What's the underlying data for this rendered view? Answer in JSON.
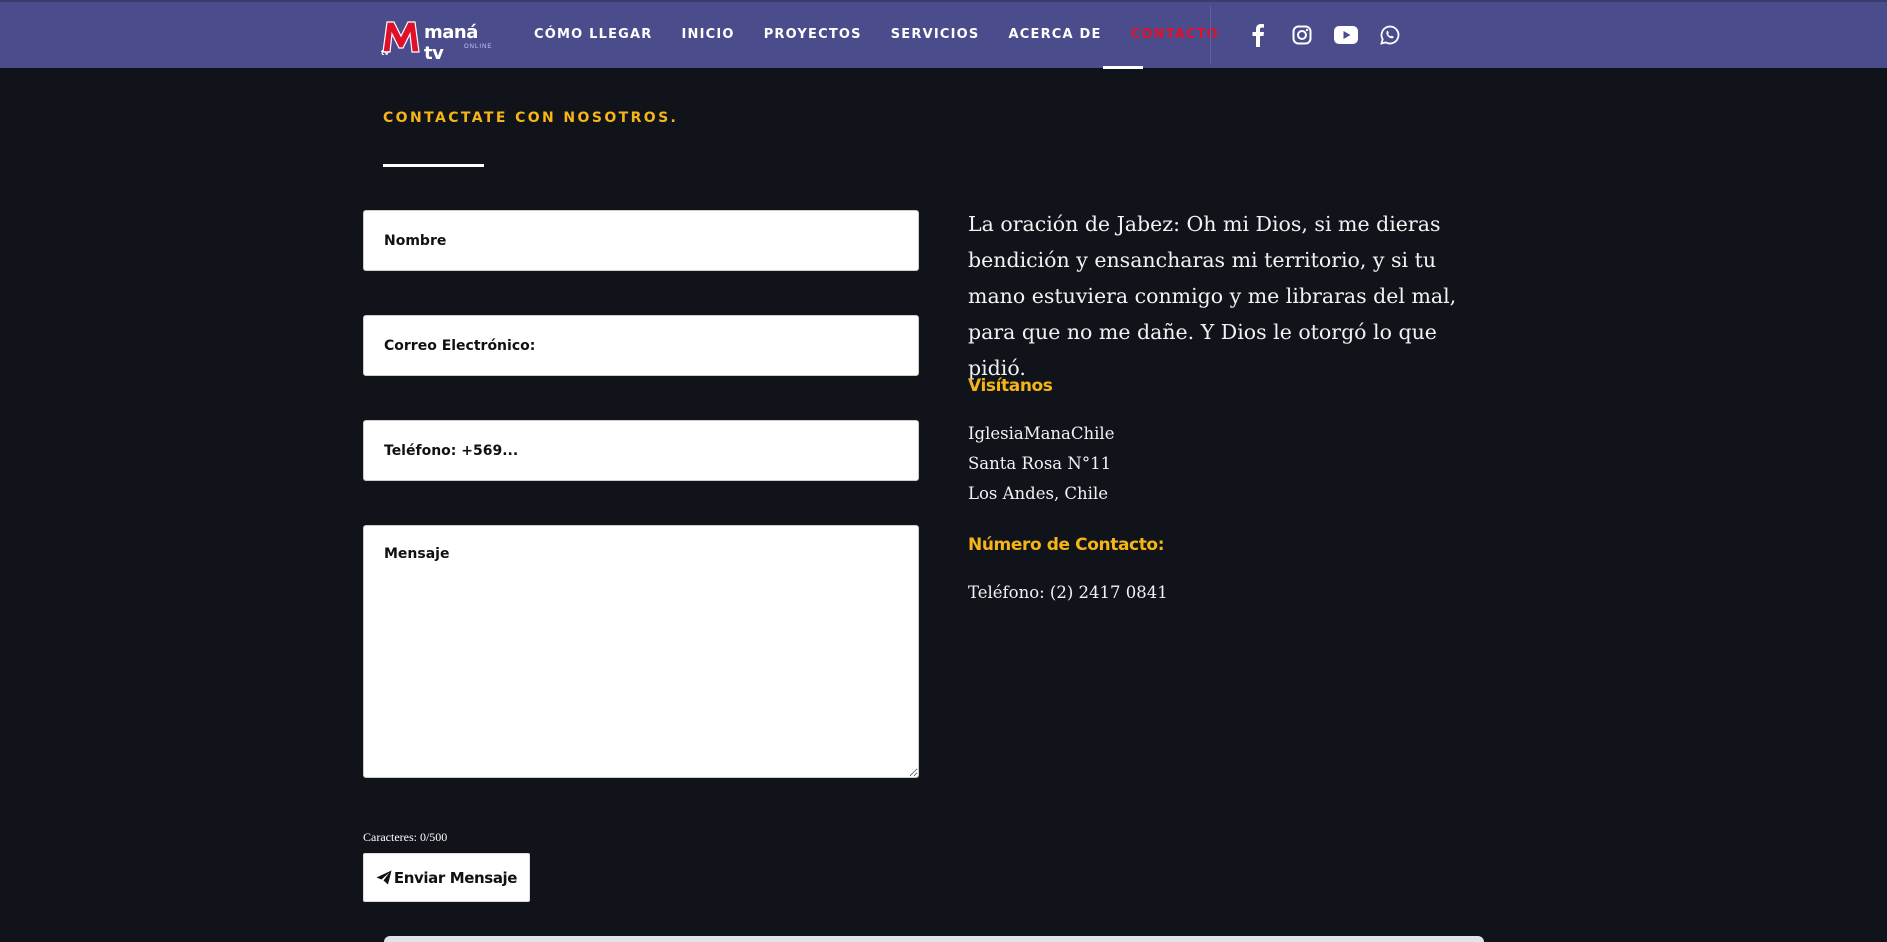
{
  "header": {
    "logo_text": "maná tv",
    "logo_sub": "ONLINE",
    "nav": [
      {
        "label": "CÓMO LLEGAR"
      },
      {
        "label": "INICIO"
      },
      {
        "label": "PROYECTOS"
      },
      {
        "label": "SERVICIOS"
      },
      {
        "label": "ACERCA DE"
      },
      {
        "label": "CONTACTO",
        "active": true
      }
    ],
    "social": [
      "facebook-icon",
      "instagram-icon",
      "youtube-icon",
      "whatsapp-icon"
    ],
    "colors": {
      "bar": "#4b4c8c",
      "active": "#e0102a"
    }
  },
  "contact": {
    "heading": "CONTACTATE CON NOSOTROS.",
    "form": {
      "name_placeholder": "Nombre",
      "email_placeholder": "Correo Electrónico:",
      "phone_placeholder": "Teléfono: +569...",
      "message_placeholder": "Mensaje",
      "char_count": "Caracteres: 0/500",
      "submit_label": "Enviar Mensaje"
    }
  },
  "info": {
    "quote": "La oración de Jabez: Oh mi Dios, si me dieras bendición y ensancharas mi territorio, y si tu mano estuviera conmigo y me libraras del mal, para que no me dañe. Y Dios le otorgó lo que pidió.",
    "visit_heading": "Visítanos",
    "address": [
      "IglesiaManaChile",
      "Santa Rosa N°11",
      "Los Andes, Chile"
    ],
    "contact_heading": "Número de Contacto:",
    "phone": "Teléfono: (2) 2417 0841"
  },
  "accent_color": "#f5b516"
}
